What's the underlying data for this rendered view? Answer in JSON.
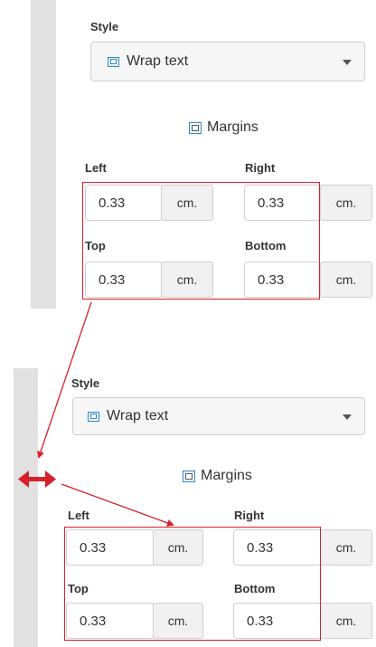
{
  "top_panel": {
    "style_label": "Style",
    "dropdown_value": "Wrap text",
    "margins_title": "Margins",
    "left_label": "Left",
    "right_label": "Right",
    "top_label": "Top",
    "bottom_label": "Bottom",
    "left_value": "0.33",
    "right_value": "0.33",
    "top_value": "0.33",
    "bottom_value": "0.33",
    "unit": "cm."
  },
  "bottom_panel": {
    "style_label": "Style",
    "dropdown_value": "Wrap text",
    "margins_title": "Margins",
    "left_label": "Left",
    "right_label": "Right",
    "top_label": "Top",
    "bottom_label": "Bottom",
    "left_value": "0.33",
    "right_value": "0.33",
    "top_value": "0.33",
    "bottom_value": "0.33",
    "unit": "cm."
  },
  "colors": {
    "annotation_red": "#d6212a",
    "icon_blue": "#2a8ad0",
    "gutter_gray": "#e1e1e1"
  },
  "icons": {
    "dropdown_icon": "wrap-text-icon",
    "margins_icon": "margins-icon",
    "resize_icon": "double-arrow-icon",
    "caret_icon": "chevron-down-icon"
  }
}
